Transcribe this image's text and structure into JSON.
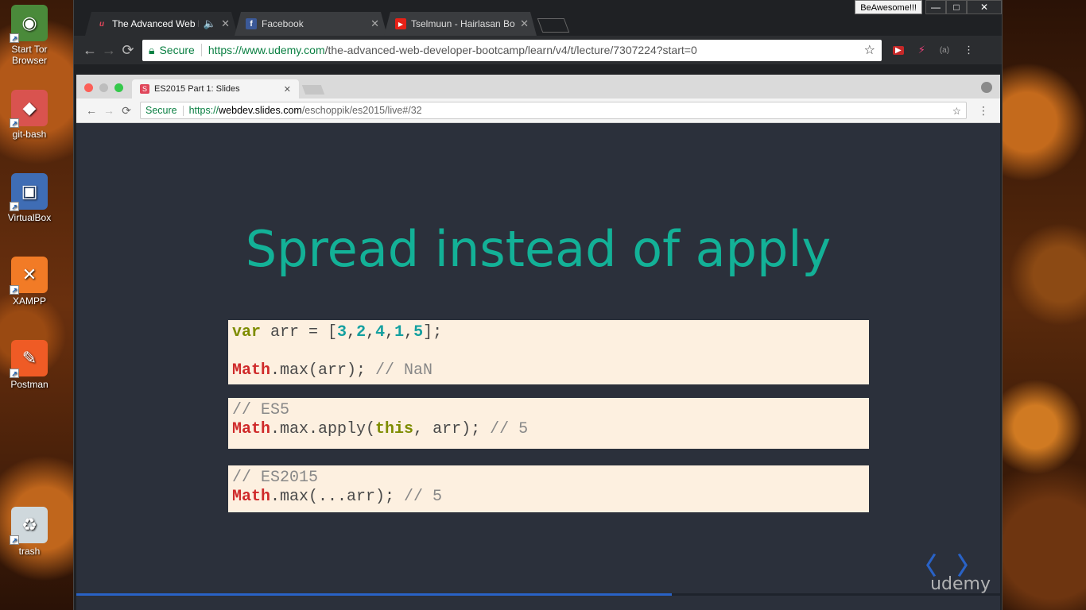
{
  "desktop": {
    "icons": [
      {
        "label": "Start Tor\nBrowser",
        "glyph": "◉",
        "color": "#4a8a3a"
      },
      {
        "label": "git-bash",
        "glyph": "◆",
        "color": "#d9534f"
      },
      {
        "label": "VirtualBox",
        "glyph": "▣",
        "color": "#3f6db5"
      },
      {
        "label": "XAMPP",
        "glyph": "✕",
        "color": "#f27b26"
      },
      {
        "label": "Postman",
        "glyph": "✎",
        "color": "#ef5b25"
      },
      {
        "label": "trash",
        "glyph": "♻",
        "color": "#cfd8dc"
      }
    ]
  },
  "window_controls": {
    "profile": "BeAwesome!!!",
    "minimize": "—",
    "maximize": "□",
    "close": "✕"
  },
  "outer_browser": {
    "tabs": [
      {
        "title": "The Advanced Web D",
        "favicon": "u",
        "favicon_color": "#e0475b",
        "audio": "🔈",
        "close": "✕"
      },
      {
        "title": "Facebook",
        "favicon": "f",
        "favicon_color": "#3b5998",
        "close": "✕"
      },
      {
        "title": "Tselmuun - Hairlasan Bol",
        "favicon": "▶",
        "favicon_color": "#e62117",
        "close": "✕"
      }
    ],
    "nav": {
      "back": "←",
      "forward": "→",
      "reload": "⟳"
    },
    "address": {
      "secure_label": "Secure",
      "url_host": "https://www.udemy.com",
      "url_path": "/the-advanced-web-developer-bootcamp/learn/v4/t/lecture/7307224?start=0"
    },
    "star": "☆",
    "extensions": [
      "▶",
      "⚡",
      "(a)",
      "⋮"
    ]
  },
  "inner_browser": {
    "tab_title": "ES2015 Part 1: Slides",
    "tab_favicon": "S",
    "tab_close": "✕",
    "nav": {
      "back": "←",
      "forward": "→",
      "reload": "⟳"
    },
    "address": {
      "secure_label": "Secure",
      "url_scheme": "https://",
      "url_domain": "webdev.slides.com",
      "url_path": "/eschoppik/es2015/live#/32"
    },
    "star": "☆",
    "menu": "⋮"
  },
  "slide": {
    "title": "Spread instead of apply",
    "progress": 0.645,
    "nav_prev": "〈",
    "nav_next": "〉",
    "watermark": "udemy"
  },
  "code_blocks": [
    {
      "lines": [
        [
          {
            "t": "var",
            "c": "kw"
          },
          {
            "t": " arr = [",
            "c": ""
          },
          {
            "t": "3",
            "c": "num"
          },
          {
            "t": ",",
            "c": ""
          },
          {
            "t": "2",
            "c": "num"
          },
          {
            "t": ",",
            "c": ""
          },
          {
            "t": "4",
            "c": "num"
          },
          {
            "t": ",",
            "c": ""
          },
          {
            "t": "1",
            "c": "num"
          },
          {
            "t": ",",
            "c": ""
          },
          {
            "t": "5",
            "c": "num"
          },
          {
            "t": "];",
            "c": ""
          }
        ],
        [],
        [
          {
            "t": "Math",
            "c": "obj"
          },
          {
            "t": ".max(arr); ",
            "c": ""
          },
          {
            "t": "// NaN",
            "c": "cm"
          }
        ]
      ]
    },
    {
      "lines": [
        [
          {
            "t": "// ES5",
            "c": "cm"
          }
        ],
        [
          {
            "t": "Math",
            "c": "obj"
          },
          {
            "t": ".max.apply(",
            "c": ""
          },
          {
            "t": "this",
            "c": "kw"
          },
          {
            "t": ", arr); ",
            "c": ""
          },
          {
            "t": "// 5",
            "c": "cm"
          }
        ]
      ]
    },
    {
      "lines": [
        [
          {
            "t": "// ES2015",
            "c": "cm"
          }
        ],
        [
          {
            "t": "Math",
            "c": "obj"
          },
          {
            "t": ".max(...arr); ",
            "c": ""
          },
          {
            "t": "// 5",
            "c": "cm"
          }
        ]
      ]
    }
  ]
}
